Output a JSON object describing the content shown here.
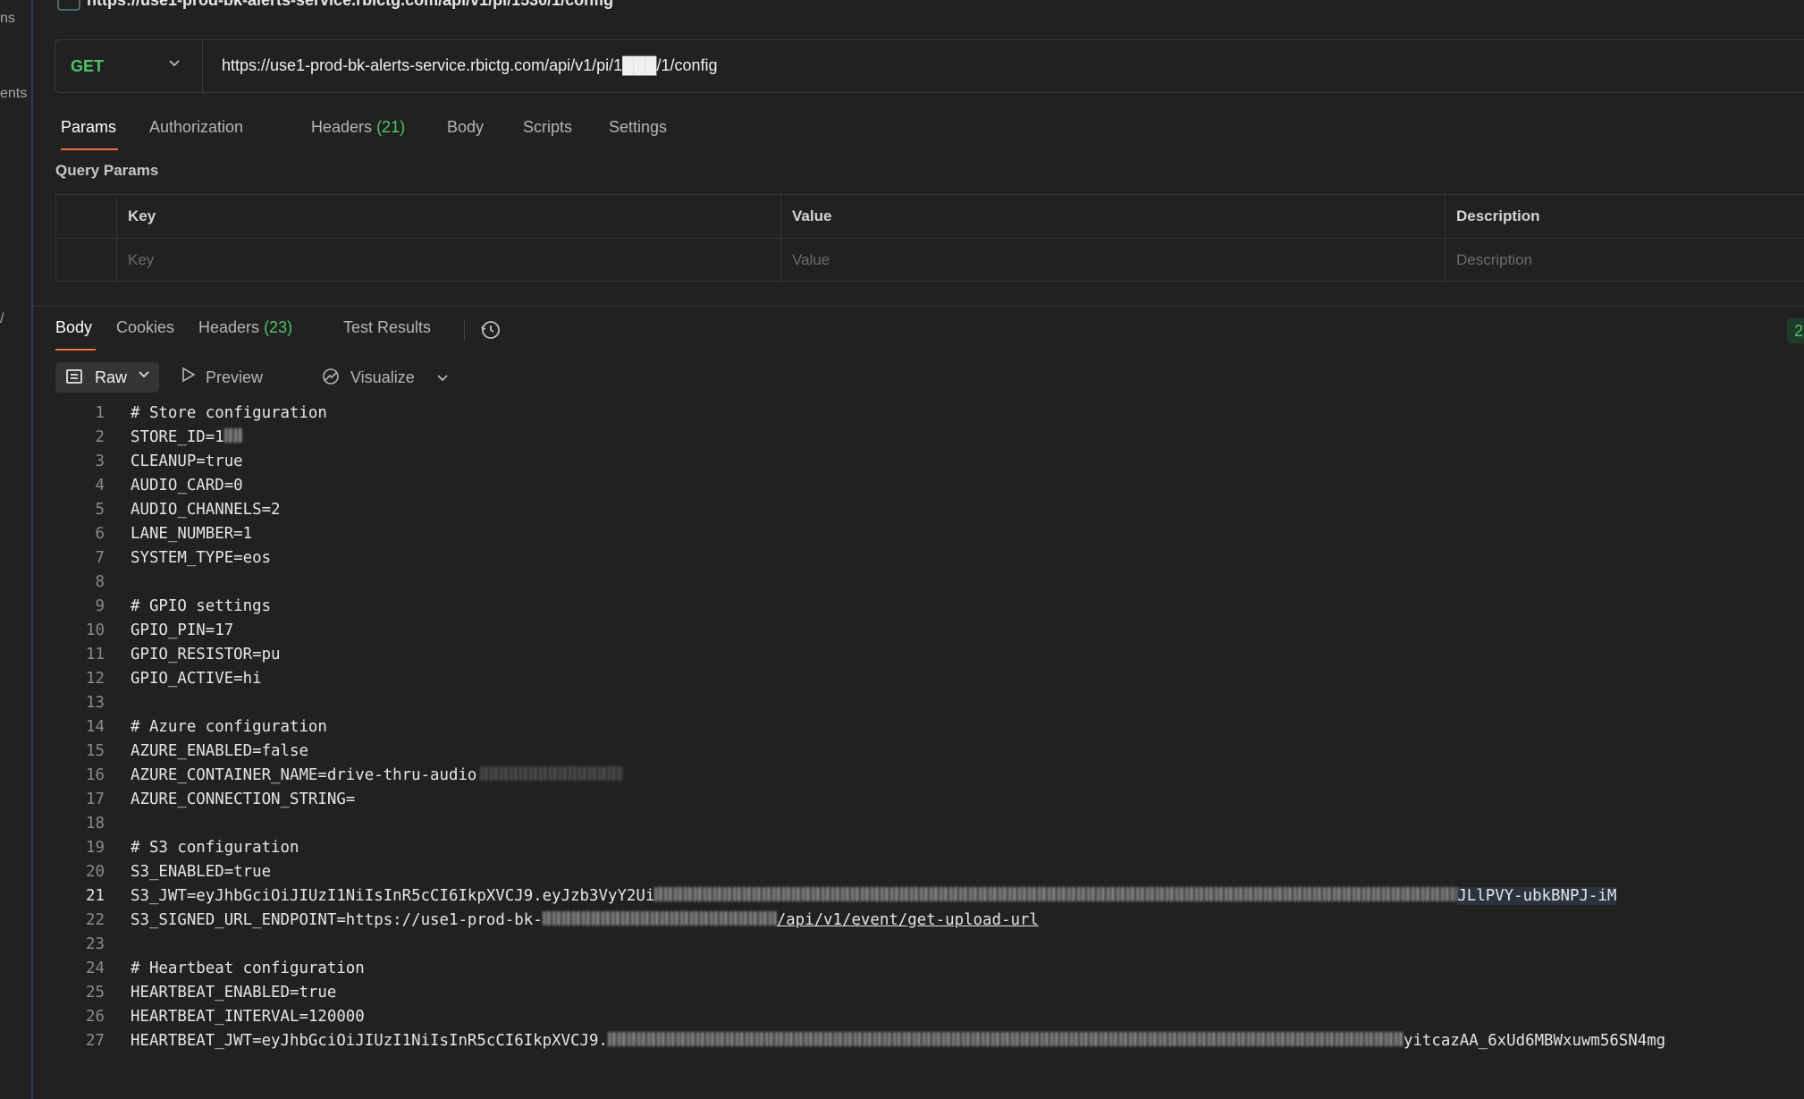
{
  "left_rail": {
    "labels": [
      "ns",
      "ents",
      "/"
    ]
  },
  "header": {
    "tab_url": "https://use1-prod-bk-alerts-service.rbictg.com/api/v1/pi/1530/1/config"
  },
  "request": {
    "method": "GET",
    "url": "https://use1-prod-bk-alerts-service.rbictg.com/api/v1/pi/1███/1/config"
  },
  "request_tabs": [
    {
      "label": "Params",
      "count": ""
    },
    {
      "label": "Authorization",
      "count": ""
    },
    {
      "label": "Headers",
      "count": "(21)"
    },
    {
      "label": "Body",
      "count": ""
    },
    {
      "label": "Scripts",
      "count": ""
    },
    {
      "label": "Settings",
      "count": ""
    }
  ],
  "query_params": {
    "title": "Query Params",
    "headers": {
      "key": "Key",
      "value": "Value",
      "description": "Description"
    },
    "placeholders": {
      "key": "Key",
      "value": "Value",
      "description": "Description"
    }
  },
  "response_tabs": [
    {
      "label": "Body",
      "count": ""
    },
    {
      "label": "Cookies",
      "count": ""
    },
    {
      "label": "Headers",
      "count": "(23)"
    },
    {
      "label": "Test Results",
      "count": ""
    }
  ],
  "status_chip": "2",
  "toolbar": {
    "raw_label": "Raw",
    "preview_label": "Preview",
    "visualize_label": "Visualize"
  },
  "code_lines": [
    "# Store configuration",
    "STORE_ID=1",
    "CLEANUP=true",
    "AUDIO_CARD=0",
    "AUDIO_CHANNELS=2",
    "LANE_NUMBER=1",
    "SYSTEM_TYPE=eos",
    "",
    "# GPIO settings",
    "GPIO_PIN=17",
    "GPIO_RESISTOR=pu",
    "GPIO_ACTIVE=hi",
    "",
    "# Azure configuration",
    "AZURE_ENABLED=false",
    "AZURE_CONTAINER_NAME=drive-thru-audio",
    "AZURE_CONNECTION_STRING=",
    "",
    "# S3 configuration",
    "S3_ENABLED=true",
    "S3_JWT=eyJhbGciOiJIUzI1NiIsInR5cCI6IkpXVCJ9.eyJzb3VyY2Ui",
    "S3_SIGNED_URL_ENDPOINT=https://use1-prod-bk-",
    "",
    "# Heartbeat configuration",
    "HEARTBEAT_ENABLED=true",
    "HEARTBEAT_INTERVAL=120000",
    "HEARTBEAT_JWT=eyJhbGciOiJIUzI1NiIsInR5cCI6IkpXVCJ9."
  ],
  "code_tails": {
    "s3_jwt_tail": "JLlPVY-ubkBNPJ-iM",
    "s3_endpoint_tail": "/api/v1/event/get-upload-url",
    "heartbeat_jwt_tail": "yitcazAA_6xUd6MBWxuwm56SN4mg"
  },
  "colors": {
    "background": "#212121",
    "accent_orange": "#f26b3a",
    "method_green": "#4ec46d",
    "count_green": "#4ec46d"
  }
}
